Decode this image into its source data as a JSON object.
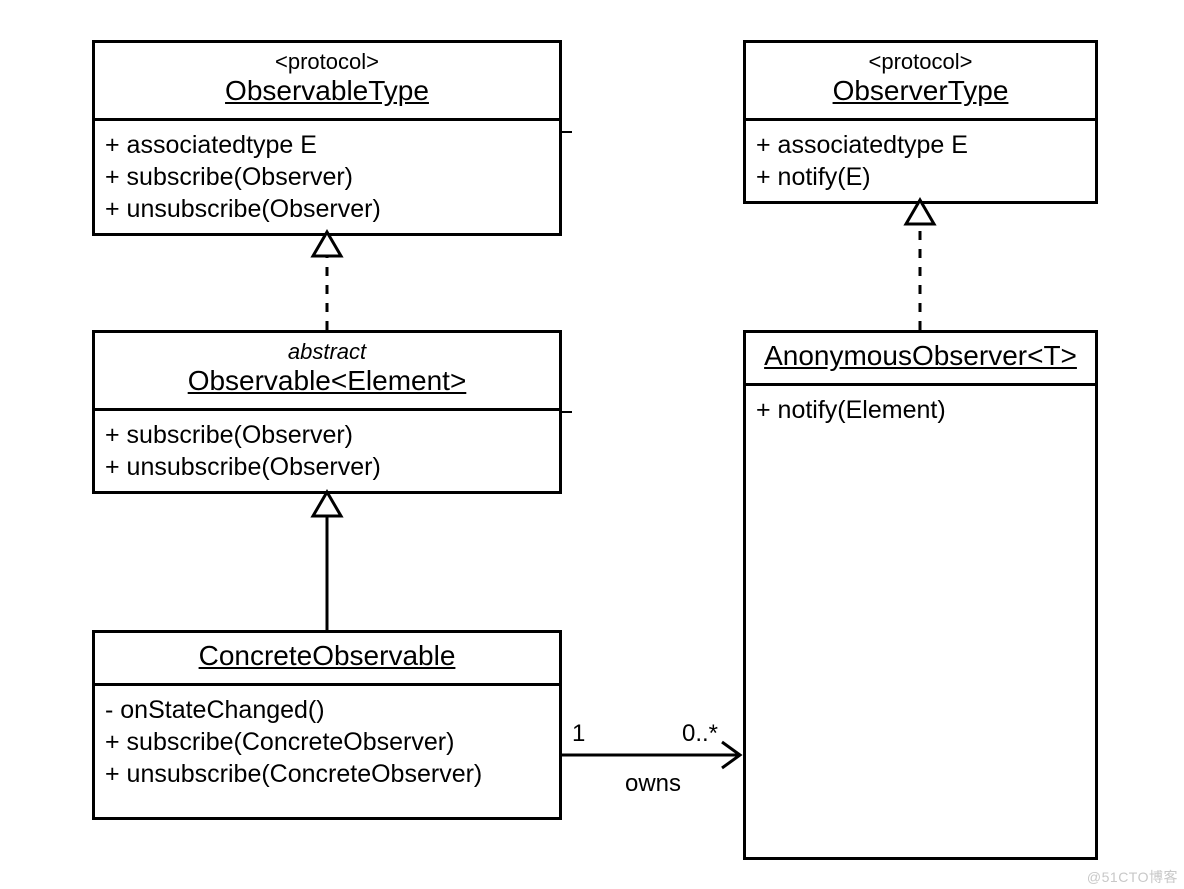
{
  "diagram_type": "UML class diagram",
  "watermark": "@51CTO博客",
  "relationships": {
    "owns_label": "owns",
    "owns_from_mult": "1",
    "owns_to_mult": "0..*"
  },
  "classes": {
    "observable_type": {
      "stereotype": "<protocol>",
      "name": "ObservableType",
      "members": [
        "+ associatedtype E",
        "+ subscribe(Observer)",
        "+ unsubscribe(Observer)"
      ]
    },
    "observer_type": {
      "stereotype": "<protocol>",
      "name": "ObserverType",
      "members": [
        "+ associatedtype E",
        "+ notify(E)"
      ]
    },
    "observable": {
      "modifier": "abstract",
      "name": "Observable<Element>",
      "members": [
        "+ subscribe(Observer)",
        "+ unsubscribe(Observer)"
      ]
    },
    "anonymous_observer": {
      "name": "AnonymousObserver<T>",
      "members": [
        "+ notify(Element)"
      ]
    },
    "concrete_observable": {
      "name": "ConcreteObservable",
      "members": [
        "- onStateChanged()",
        "+ subscribe(ConcreteObserver)",
        "+ unsubscribe(ConcreteObserver)"
      ]
    }
  }
}
